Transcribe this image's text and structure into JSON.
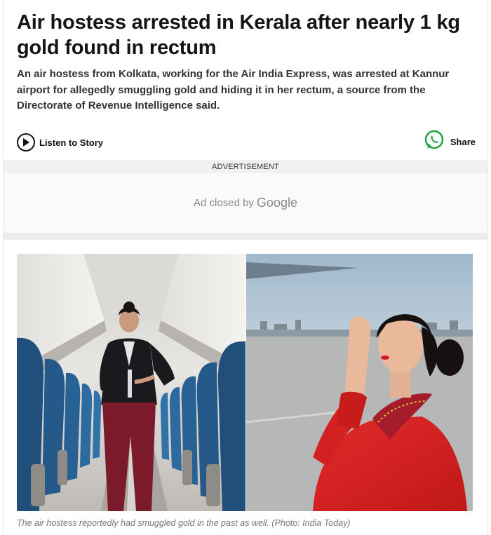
{
  "article": {
    "headline": "Air hostess arrested in Kerala after nearly 1 kg gold found in rectum",
    "summary": "An air hostess from Kolkata, working for the Air India Express, was arrested at Kannur airport for allegedly smuggling gold and hiding it in her rectum, a source from the Directorate of Revenue Intelligence said."
  },
  "actions": {
    "listen_label": "Listen to Story",
    "listen_icon": "play-circle-icon",
    "share_label": "Share",
    "share_icon": "whatsapp-icon",
    "share_color": "#25a244"
  },
  "ad": {
    "label": "ADVERTISEMENT",
    "closed_text": "Ad closed by",
    "closed_brand": "Google"
  },
  "images": {
    "left_description_icon": "air-hostess-in-aircraft-aisle-photo",
    "right_description_icon": "air-hostess-in-red-uniform-photo"
  },
  "caption": "The air hostess reportedly had smuggled gold in the past as well. (Photo: India Today)"
}
